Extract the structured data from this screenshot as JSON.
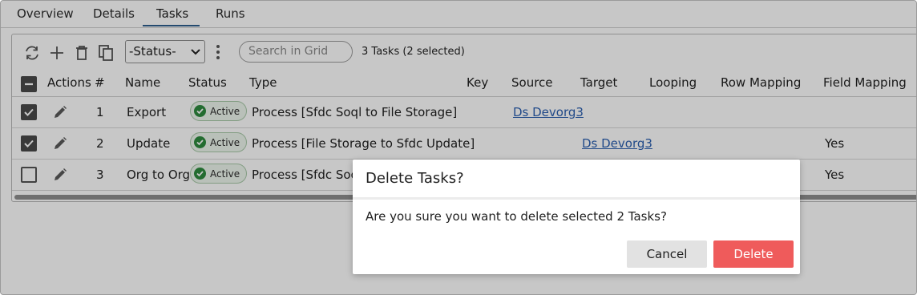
{
  "tabs": [
    {
      "label": "Overview"
    },
    {
      "label": "Details"
    },
    {
      "label": "Tasks"
    },
    {
      "label": "Runs"
    }
  ],
  "active_tab": "Tasks",
  "toolbar": {
    "status_select_value": "-Status-",
    "search_placeholder": "Search in Grid",
    "task_count": "3 Tasks (2 selected)"
  },
  "table": {
    "headers": {
      "actions": "Actions",
      "num": "#",
      "name": "Name",
      "status": "Status",
      "type": "Type",
      "key": "Key",
      "source": "Source",
      "target": "Target",
      "looping": "Looping",
      "row_mapping": "Row Mapping",
      "field_mapping": "Field Mapping"
    },
    "rows": [
      {
        "checked": true,
        "num": "1",
        "name": "Export",
        "status": "Active",
        "type": "Process [Sfdc Soql to File Storage]",
        "source": "Ds Devorg3",
        "target": "",
        "field_mapping": ""
      },
      {
        "checked": true,
        "num": "2",
        "name": "Update",
        "status": "Active",
        "type": "Process [File Storage to Sfdc Update]",
        "source": "",
        "target": "Ds Devorg3",
        "field_mapping": "Yes"
      },
      {
        "checked": false,
        "num": "3",
        "name": "Org to Org",
        "status": "Active",
        "type": "Process [Sfdc Soc",
        "source": "",
        "target": "",
        "field_mapping": "Yes"
      }
    ]
  },
  "dialog": {
    "title": "Delete Tasks?",
    "message": "Are you sure you want to delete selected 2 Tasks?",
    "cancel_label": "Cancel",
    "delete_label": "Delete"
  },
  "colors": {
    "delete_button": "#ef5b5b",
    "active_badge": "#2e8b3e",
    "link": "#2b5fb0",
    "tab_underline": "#2f5f8f"
  }
}
